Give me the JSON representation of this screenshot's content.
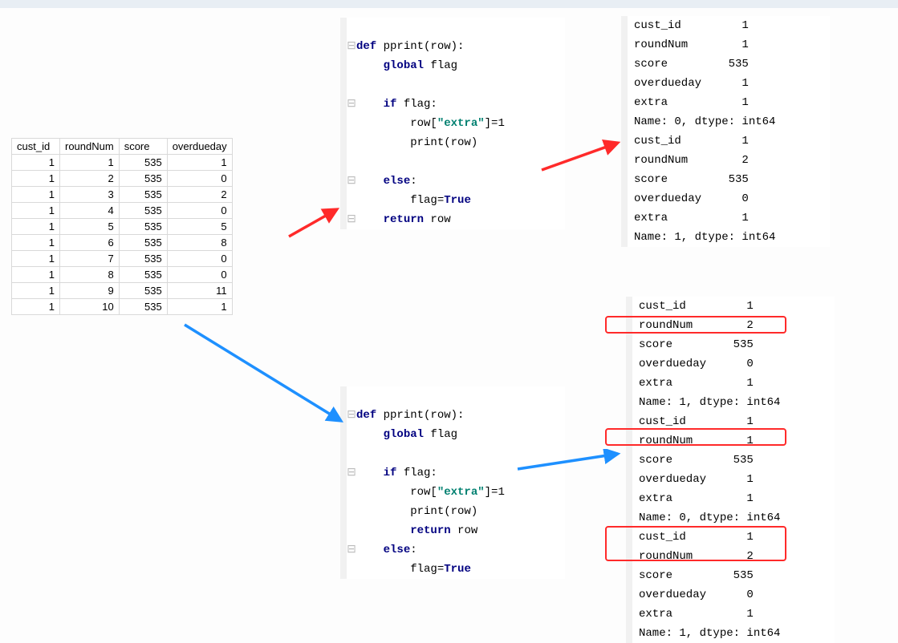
{
  "table": {
    "headers": [
      "cust_id",
      "roundNum",
      "score",
      "overdueday"
    ],
    "rows": [
      [
        1,
        1,
        535,
        1
      ],
      [
        1,
        2,
        535,
        0
      ],
      [
        1,
        3,
        535,
        2
      ],
      [
        1,
        4,
        535,
        0
      ],
      [
        1,
        5,
        535,
        5
      ],
      [
        1,
        6,
        535,
        8
      ],
      [
        1,
        7,
        535,
        0
      ],
      [
        1,
        8,
        535,
        0
      ],
      [
        1,
        9,
        535,
        11
      ],
      [
        1,
        10,
        535,
        1
      ]
    ]
  },
  "code1": {
    "l1_def": "def ",
    "l1_fn": "pprint",
    "l1_rest": "(row):",
    "l2_kw": "global",
    "l2_rest": " flag",
    "l3_kw": "if",
    "l3_rest": " flag:",
    "l4_a": "row[",
    "l4_str": "\"extra\"",
    "l4_b": "]=",
    "l4_c": "1",
    "l5": "print(row)",
    "l6_kw": "else",
    "l6_rest": ":",
    "l7_a": "flag=",
    "l7_b": "True",
    "l8_kw": "return",
    "l8_rest": " row"
  },
  "code2": {
    "l1_def": "def ",
    "l1_fn": "pprint",
    "l1_rest": "(row):",
    "l2_kw": "global",
    "l2_rest": " flag",
    "l3_kw": "if",
    "l3_rest": " flag:",
    "l4_a": "row[",
    "l4_str": "\"extra\"",
    "l4_b": "]=",
    "l4_c": "1",
    "l5": "print(row)",
    "l6_kw": "return",
    "l6_rest": " row",
    "l7_kw": "else",
    "l7_rest": ":",
    "l8_a": "flag=",
    "l8_b": "True"
  },
  "out1": {
    "lines": [
      "cust_id         1",
      "roundNum        1",
      "score         535",
      "overdueday      1",
      "extra           1",
      "Name: 0, dtype: int64",
      "cust_id         1",
      "roundNum        2",
      "score         535",
      "overdueday      0",
      "extra           1",
      "Name: 1, dtype: int64"
    ]
  },
  "out2": {
    "lines": [
      "cust_id         1",
      "roundNum        2",
      "score         535",
      "overdueday      0",
      "extra           1",
      "Name: 1, dtype: int64",
      "cust_id         1",
      "roundNum        1",
      "score         535",
      "overdueday      1",
      "extra           1",
      "Name: 0, dtype: int64",
      "cust_id         1",
      "roundNum        2",
      "score         535",
      "overdueday      0",
      "extra           1",
      "Name: 1, dtype: int64"
    ]
  }
}
